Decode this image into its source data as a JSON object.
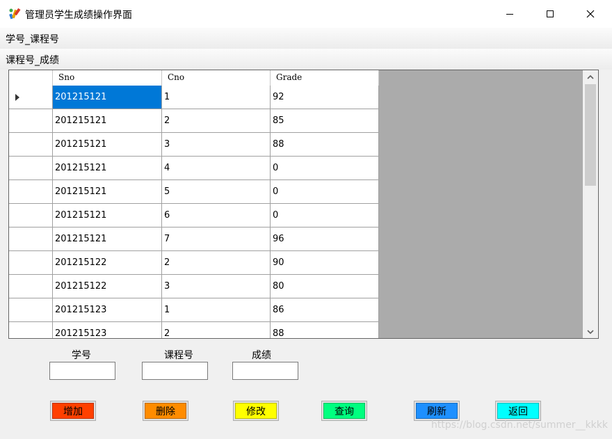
{
  "window": {
    "title": "管理员学生成绩操作界面",
    "icons": {
      "app": "app-paint-icon",
      "minimize": "minimize-icon",
      "maximize": "maximize-icon",
      "close": "close-icon"
    }
  },
  "menu": {
    "row1": "学号_课程号",
    "row2": "课程号_成绩"
  },
  "grid": {
    "headers": [
      "Sno",
      "Cno",
      "Grade"
    ],
    "rows": [
      [
        "201215121",
        "1",
        "92"
      ],
      [
        "201215121",
        "2",
        "85"
      ],
      [
        "201215121",
        "3",
        "88"
      ],
      [
        "201215121",
        "4",
        "0"
      ],
      [
        "201215121",
        "5",
        "0"
      ],
      [
        "201215121",
        "6",
        "0"
      ],
      [
        "201215121",
        "7",
        "96"
      ],
      [
        "201215122",
        "2",
        "90"
      ],
      [
        "201215122",
        "3",
        "80"
      ],
      [
        "201215123",
        "1",
        "86"
      ],
      [
        "201215123",
        "2",
        "88"
      ]
    ],
    "current_row_icon": "current-row-triangle-icon",
    "selection_color": "#0078d7",
    "empty_area_color": "#ababab"
  },
  "form": {
    "sno_label": "学号",
    "cno_label": "课程号",
    "grade_label": "成绩",
    "sno_value": "",
    "cno_value": "",
    "grade_value": ""
  },
  "buttons": [
    {
      "label": "增加",
      "color": "#ff4000"
    },
    {
      "label": "删除",
      "color": "#ff8c00"
    },
    {
      "label": "修改",
      "color": "#ffff00"
    },
    {
      "label": "查询",
      "color": "#00ff7f"
    },
    {
      "label": "刷新",
      "color": "#1e90ff"
    },
    {
      "label": "返回",
      "color": "#00ffff"
    }
  ],
  "watermark": "https://blog.csdn.net/summer__kkkk"
}
